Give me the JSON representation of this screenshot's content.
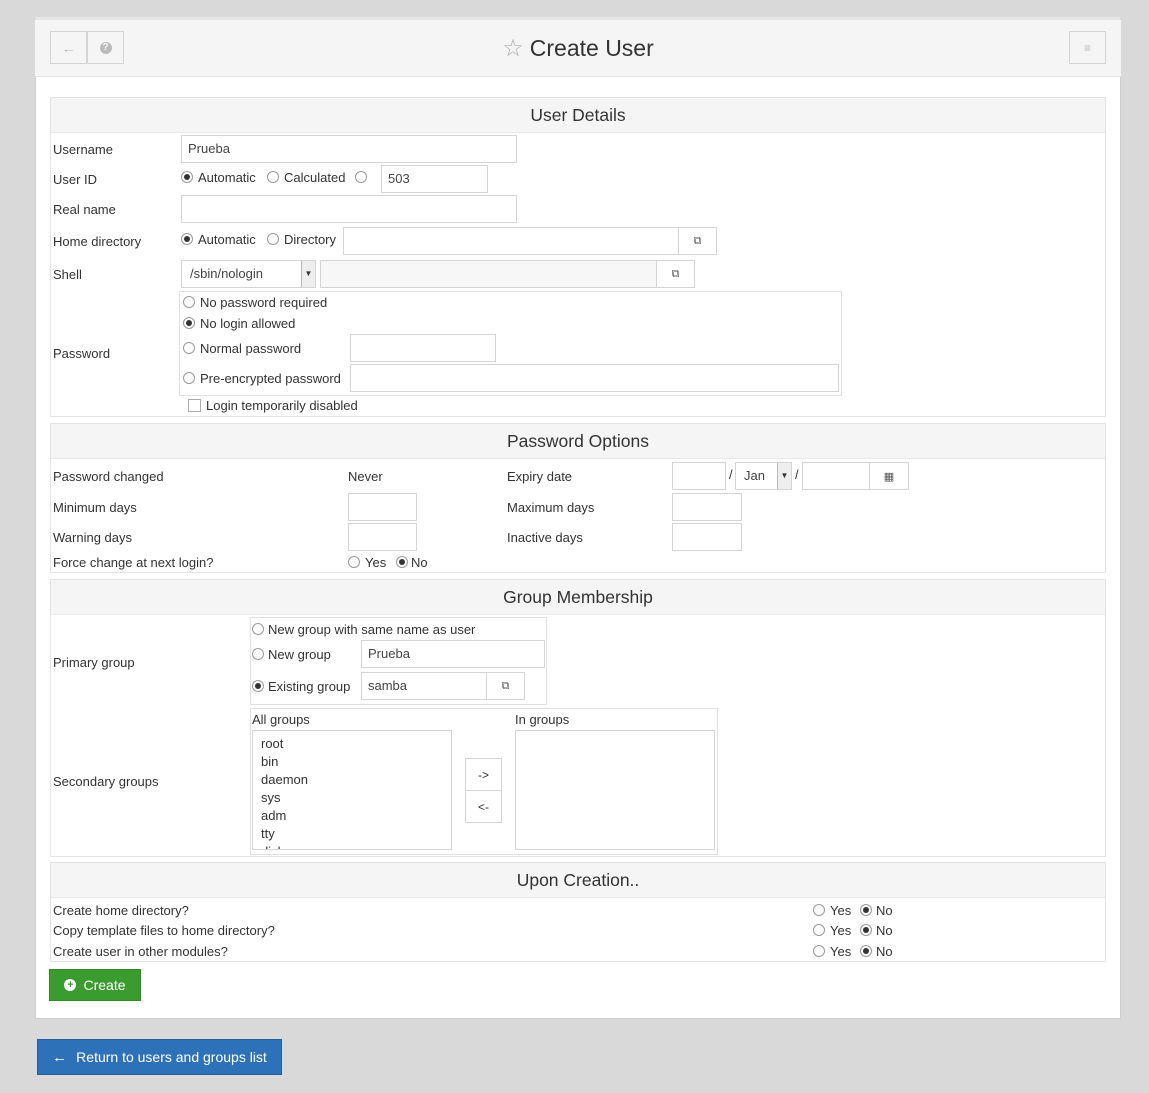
{
  "header": {
    "title": "Create User"
  },
  "user_details": {
    "title": "User Details",
    "username_label": "Username",
    "username_value": "Prueba",
    "userid_label": "User ID",
    "userid_automatic": "Automatic",
    "userid_calculated": "Calculated",
    "userid_value": "503",
    "realname_label": "Real name",
    "homedir_label": "Home directory",
    "homedir_automatic": "Automatic",
    "homedir_directory": "Directory",
    "shell_label": "Shell",
    "shell_value": "/sbin/nologin",
    "password_label": "Password",
    "pw_none": "No password required",
    "pw_nologin": "No login allowed",
    "pw_normal": "Normal password",
    "pw_preenc": "Pre-encrypted password",
    "login_disabled": "Login temporarily disabled"
  },
  "password_options": {
    "title": "Password Options",
    "changed_label": "Password changed",
    "changed_value": "Never",
    "expiry_label": "Expiry date",
    "expiry_month": "Jan",
    "slash": "/",
    "min_days_label": "Minimum days",
    "max_days_label": "Maximum days",
    "warn_days_label": "Warning days",
    "inactive_days_label": "Inactive days",
    "force_label": "Force change at next login?",
    "yes": "Yes",
    "no": "No"
  },
  "group_membership": {
    "title": "Group Membership",
    "primary_label": "Primary group",
    "new_same": "New group with same name as user",
    "new_group": "New group",
    "new_group_value": "Prueba",
    "existing_group": "Existing group",
    "existing_group_value": "samba",
    "secondary_label": "Secondary groups",
    "all_groups_label": "All groups",
    "in_groups_label": "In groups",
    "all_groups": [
      "root",
      "bin",
      "daemon",
      "sys",
      "adm",
      "tty",
      "disk"
    ],
    "add_label": "->",
    "remove_label": "<-"
  },
  "upon_creation": {
    "title": "Upon Creation..",
    "rows": [
      {
        "label": "Create home directory?"
      },
      {
        "label": "Copy template files to home directory?"
      },
      {
        "label": "Create user in other modules?"
      }
    ],
    "yes": "Yes",
    "no": "No"
  },
  "buttons": {
    "create": "Create",
    "return": "Return to users and groups list"
  }
}
